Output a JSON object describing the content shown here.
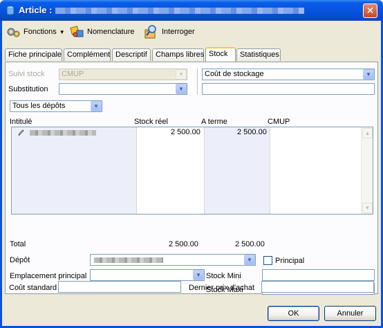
{
  "window": {
    "title": "Article :",
    "close_label": "✕"
  },
  "toolbar": {
    "fonctions_label": "Fonctions",
    "nomenclature_label": "Nomenclature",
    "interroger_label": "Interroger"
  },
  "tabs": [
    {
      "label": "Fiche principale"
    },
    {
      "label": "Complément"
    },
    {
      "label": "Descriptif"
    },
    {
      "label": "Champs libres"
    },
    {
      "label": "Stock"
    },
    {
      "label": "Statistiques"
    }
  ],
  "form": {
    "suivi_stock_label": "Suivi stock",
    "suivi_stock_value": "CMUP",
    "substitution_label": "Substitution",
    "substitution_value": "",
    "cout_stockage_value": "Coût de stockage",
    "cout_stockage_input": "",
    "depots_filter_value": "Tous les dépôts"
  },
  "grid": {
    "columns": [
      "Intitulé",
      "Stock réel",
      "A terme",
      "CMUP"
    ],
    "rows": [
      {
        "intitule": "",
        "stock_reel": "2 500.00",
        "a_terme": "2 500.00",
        "cmup": ""
      }
    ]
  },
  "totals": {
    "label": "Total",
    "stock_reel": "2 500.00",
    "a_terme": "2 500.00"
  },
  "lower": {
    "depot_label": "Dépôt",
    "principal_label": "Principal",
    "principal_checked": false,
    "emplacement_label": "Emplacement principal",
    "emplacement_value": "",
    "stock_mini_label": "Stock Mini",
    "stock_mini_value": "",
    "stock_maxi_label": "Stock Maxi",
    "stock_maxi_value": "",
    "cout_standard_label": "Coût standard",
    "cout_standard_value": "",
    "dernier_prix_label": "Dernier prix d'achat",
    "dernier_prix_value": ""
  },
  "buttons": {
    "ok_label": "OK",
    "annuler_label": "Annuler"
  },
  "colors": {
    "title_bar": "#0654e0",
    "client_bg": "#ece9d8",
    "active_tab_accent": "#ffc83c"
  }
}
